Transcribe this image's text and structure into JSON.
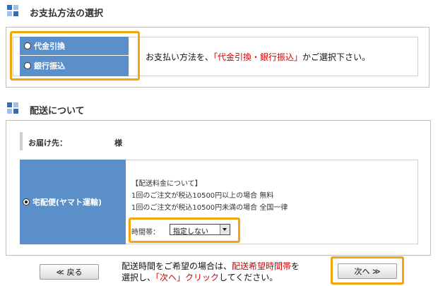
{
  "payment": {
    "heading": "お支払方法の選択",
    "options": [
      "代金引換",
      "銀行振込"
    ],
    "message_pre": "お支払い方法を、",
    "message_highlight": "「代金引換・銀行振込」",
    "message_post": "かご選択下さい。"
  },
  "delivery": {
    "heading": "配送について",
    "address_label": "お届け先：",
    "address_suffix": "様",
    "method": "宅配便(ヤマト運輸)",
    "fee_title": "【配送料金について】",
    "fee_line1": "1回のご注文が税込10500円以上の場合 無料",
    "fee_line2": "1回のご注文が税込10500円未満の場合 全国一律",
    "time_label": "時間帯：",
    "time_selected": "指定しない"
  },
  "footer": {
    "back_label": "≪ 戻る",
    "next_label": "次へ ≫",
    "msg_line1_pre": "配送時間をご希望の場合は、",
    "msg_line1_highlight": "配送希望時間帯",
    "msg_line1_post": "を",
    "msg_line2_pre": "選択し、",
    "msg_line2_highlight": "「次へ」クリック",
    "msg_line2_post": "してください。"
  },
  "colors": {
    "accent_blue": "#5b8fc9",
    "highlight_orange": "#f6a40c",
    "highlight_red": "#d40000"
  }
}
